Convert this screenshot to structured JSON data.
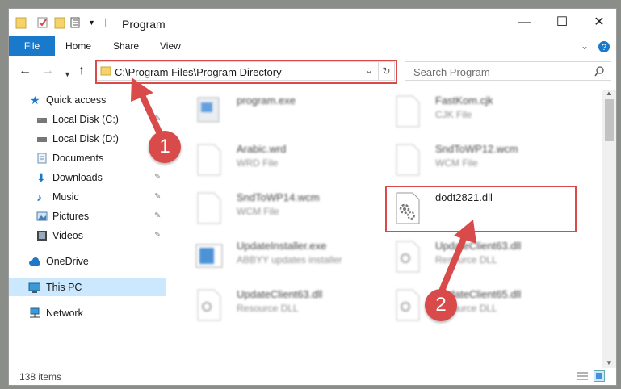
{
  "window": {
    "title": "Program",
    "controls": {
      "minimize": "—",
      "maximize": "☐",
      "close": "✕"
    }
  },
  "ribbon": {
    "tabs": [
      "File",
      "Home",
      "Share",
      "View"
    ],
    "expand_icon": "chevron-down-icon",
    "help": "?"
  },
  "address": {
    "path": "C:\\Program Files\\Program Directory",
    "refresh_icon": "refresh-icon"
  },
  "search": {
    "placeholder": "Search Program"
  },
  "sidebar": {
    "items": [
      {
        "label": "Quick access",
        "icon": "star-icon",
        "color": "#1e78c8"
      },
      {
        "label": "Local Disk (C:)",
        "icon": "drive-icon",
        "color": "#555555"
      },
      {
        "label": "Local Disk (D:)",
        "icon": "drive-icon",
        "color": "#555555"
      },
      {
        "label": "Documents",
        "icon": "documents-icon",
        "color": "#6b8fb3"
      },
      {
        "label": "Downloads",
        "icon": "download-icon",
        "color": "#1e78c8"
      },
      {
        "label": "Music",
        "icon": "music-icon",
        "color": "#1e78c8"
      },
      {
        "label": "Pictures",
        "icon": "pictures-icon",
        "color": "#4a7db0"
      },
      {
        "label": "Videos",
        "icon": "videos-icon",
        "color": "#444444"
      },
      {
        "label": "OneDrive",
        "icon": "cloud-icon",
        "color": "#1e78c8"
      },
      {
        "label": "This PC",
        "icon": "computer-icon",
        "color": "#3a9ad9"
      },
      {
        "label": "Network",
        "icon": "network-icon",
        "color": "#3a9ad9"
      }
    ]
  },
  "files": [
    {
      "name": "program.exe",
      "type": ""
    },
    {
      "name": "FastKom.cjk",
      "type": "CJK File"
    },
    {
      "name": "Arabic.wrd",
      "type": "WRD File"
    },
    {
      "name": "SndToWP12.wcm",
      "type": "WCM File"
    },
    {
      "name": "SndToWP14.wcm",
      "type": "WCM File"
    },
    {
      "name": "dodt2821.dll",
      "type": ""
    },
    {
      "name": "UpdateInstaller.exe",
      "type": "ABBYY updates installer"
    },
    {
      "name": "UpdateClient63.dll",
      "type": "Resource DLL"
    },
    {
      "name": "UpdateClient63.dll",
      "type": "Resource DLL"
    },
    {
      "name": "UpdateClient65.dll",
      "type": "Resource DLL"
    }
  ],
  "status": {
    "item_count": "138 items"
  },
  "annotations": {
    "step1": "1",
    "step2": "2",
    "color": "#d94a4a"
  }
}
